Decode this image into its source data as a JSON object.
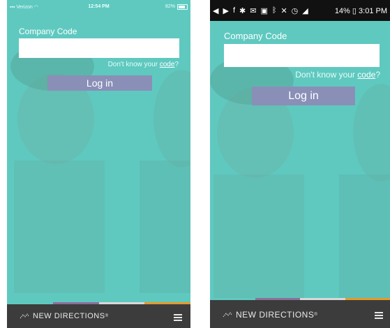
{
  "colors": {
    "background_teal": "#5fc9c0",
    "login_button": "#8a8fb7",
    "footer": "#3c3c3c",
    "accent_segments": [
      "#5fc9c0",
      "#8a6f9a",
      "#d8d8d8",
      "#e39b2a"
    ]
  },
  "ios": {
    "statusbar": {
      "carrier": "Verizon",
      "time": "12:54 PM",
      "battery": "82%"
    },
    "form": {
      "company_code_label": "Company Code",
      "company_code_value": "",
      "helper_text": "Don't know your",
      "helper_link": "code",
      "helper_suffix": "?",
      "login_label": "Log in"
    },
    "footer": {
      "brand": "NEW DIRECTIONS",
      "trademark": "®",
      "menu_icon": "hamburger-menu-icon"
    }
  },
  "android": {
    "statusbar": {
      "battery": "14%",
      "time": "3:01 PM"
    },
    "form": {
      "company_code_label": "Company Code",
      "company_code_value": "",
      "helper_text": "Don't know your",
      "helper_link": "code",
      "helper_suffix": "?",
      "login_label": "Log in"
    },
    "footer": {
      "brand": "NEW DIRECTIONS",
      "trademark": "®",
      "menu_icon": "hamburger-menu-icon"
    }
  }
}
